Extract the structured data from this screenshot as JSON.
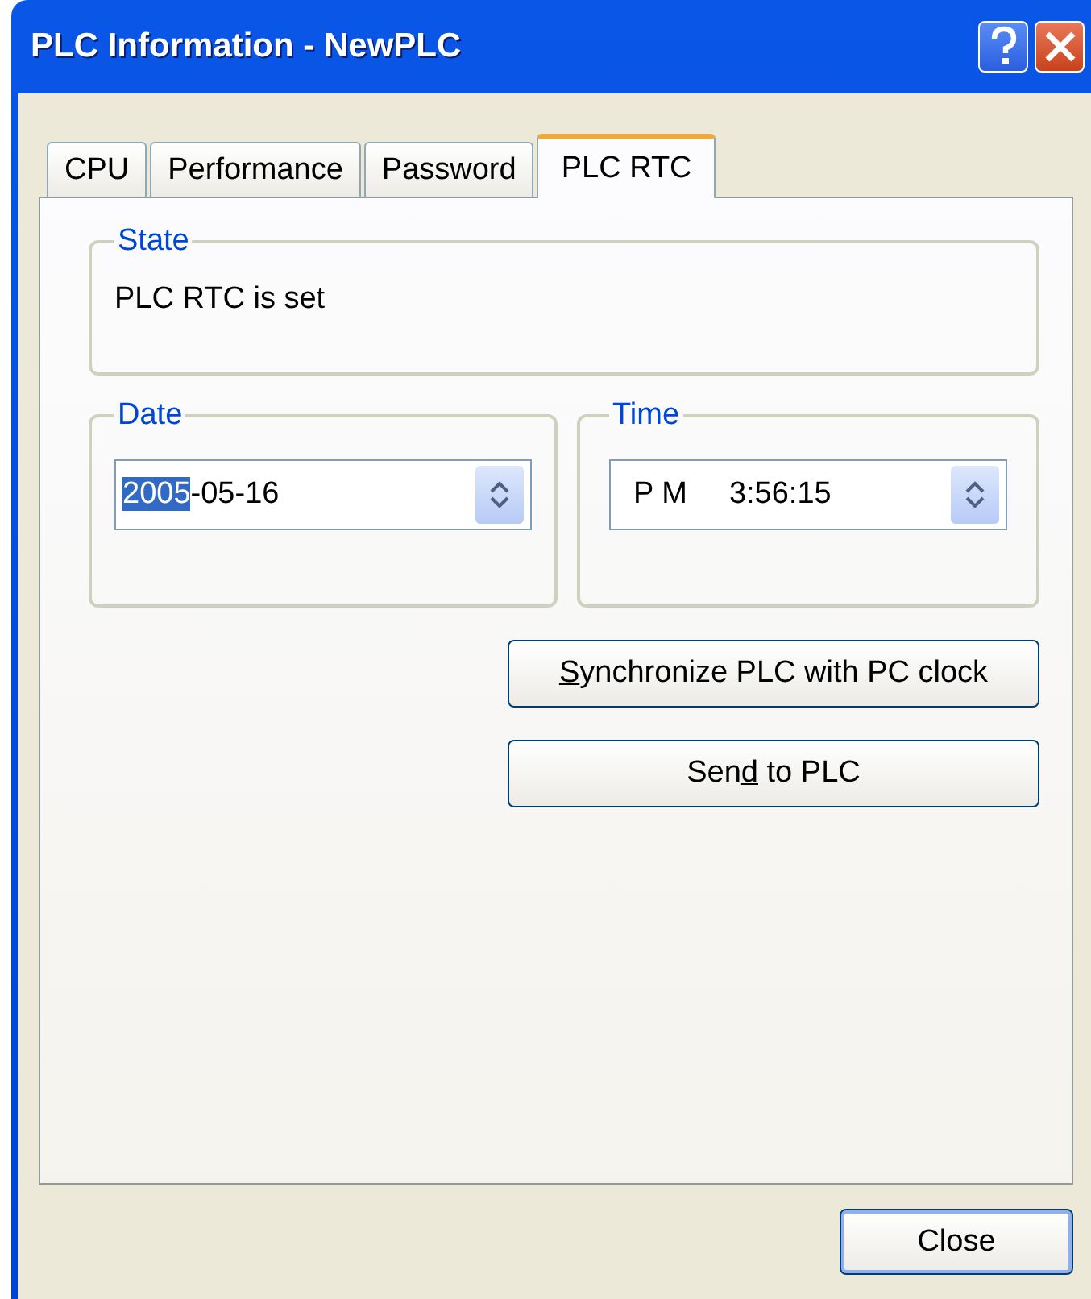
{
  "window": {
    "title": "PLC Information - NewPLC"
  },
  "tabs": [
    {
      "label": "CPU",
      "selected": false
    },
    {
      "label": "Performance",
      "selected": false
    },
    {
      "label": "Password",
      "selected": false
    },
    {
      "label": "PLC RTC",
      "selected": true
    }
  ],
  "state_group": {
    "legend": "State",
    "text": "PLC RTC is set"
  },
  "date_group": {
    "legend": "Date",
    "selected_part": "2005",
    "rest": "-05-16"
  },
  "time_group": {
    "legend": "Time",
    "period": "P M",
    "value": "3:56:15"
  },
  "buttons": [
    {
      "key": "S",
      "after": "ynchronize PLC with PC clock"
    },
    {
      "before": "Sen",
      "key": "d",
      "after": " to PLC"
    }
  ],
  "close_button": "Close"
}
